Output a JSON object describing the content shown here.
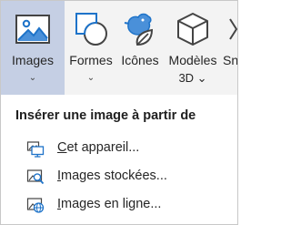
{
  "ribbon": {
    "buttons": [
      {
        "label": "Images",
        "sub": "⌄",
        "icon": "picture-icon",
        "selected": true
      },
      {
        "label": "Formes",
        "sub": "⌄",
        "icon": "shapes-icon"
      },
      {
        "label": "Icônes",
        "sub": "",
        "icon": "bird-leaf-icon"
      },
      {
        "label": "Modèles",
        "sub": "3D ⌄",
        "icon": "cube-3d-icon"
      },
      {
        "label": "Sn",
        "sub": "",
        "icon": "smartart-icon"
      }
    ]
  },
  "menu": {
    "header": "Insérer une image à partir de",
    "items": [
      {
        "mnemonic": "C",
        "rest": "et appareil...",
        "icon": "this-device-icon"
      },
      {
        "mnemonic": "I",
        "rest": "mages stockées...",
        "icon": "stock-images-icon"
      },
      {
        "mnemonic": "I",
        "rest": "mages en ligne...",
        "icon": "online-images-icon"
      }
    ]
  },
  "colors": {
    "ribbon_bg": "#f3f3f3",
    "selected_bg": "#c5cfe4",
    "accent_blue": "#1e73c9",
    "icon_dark": "#444444"
  }
}
